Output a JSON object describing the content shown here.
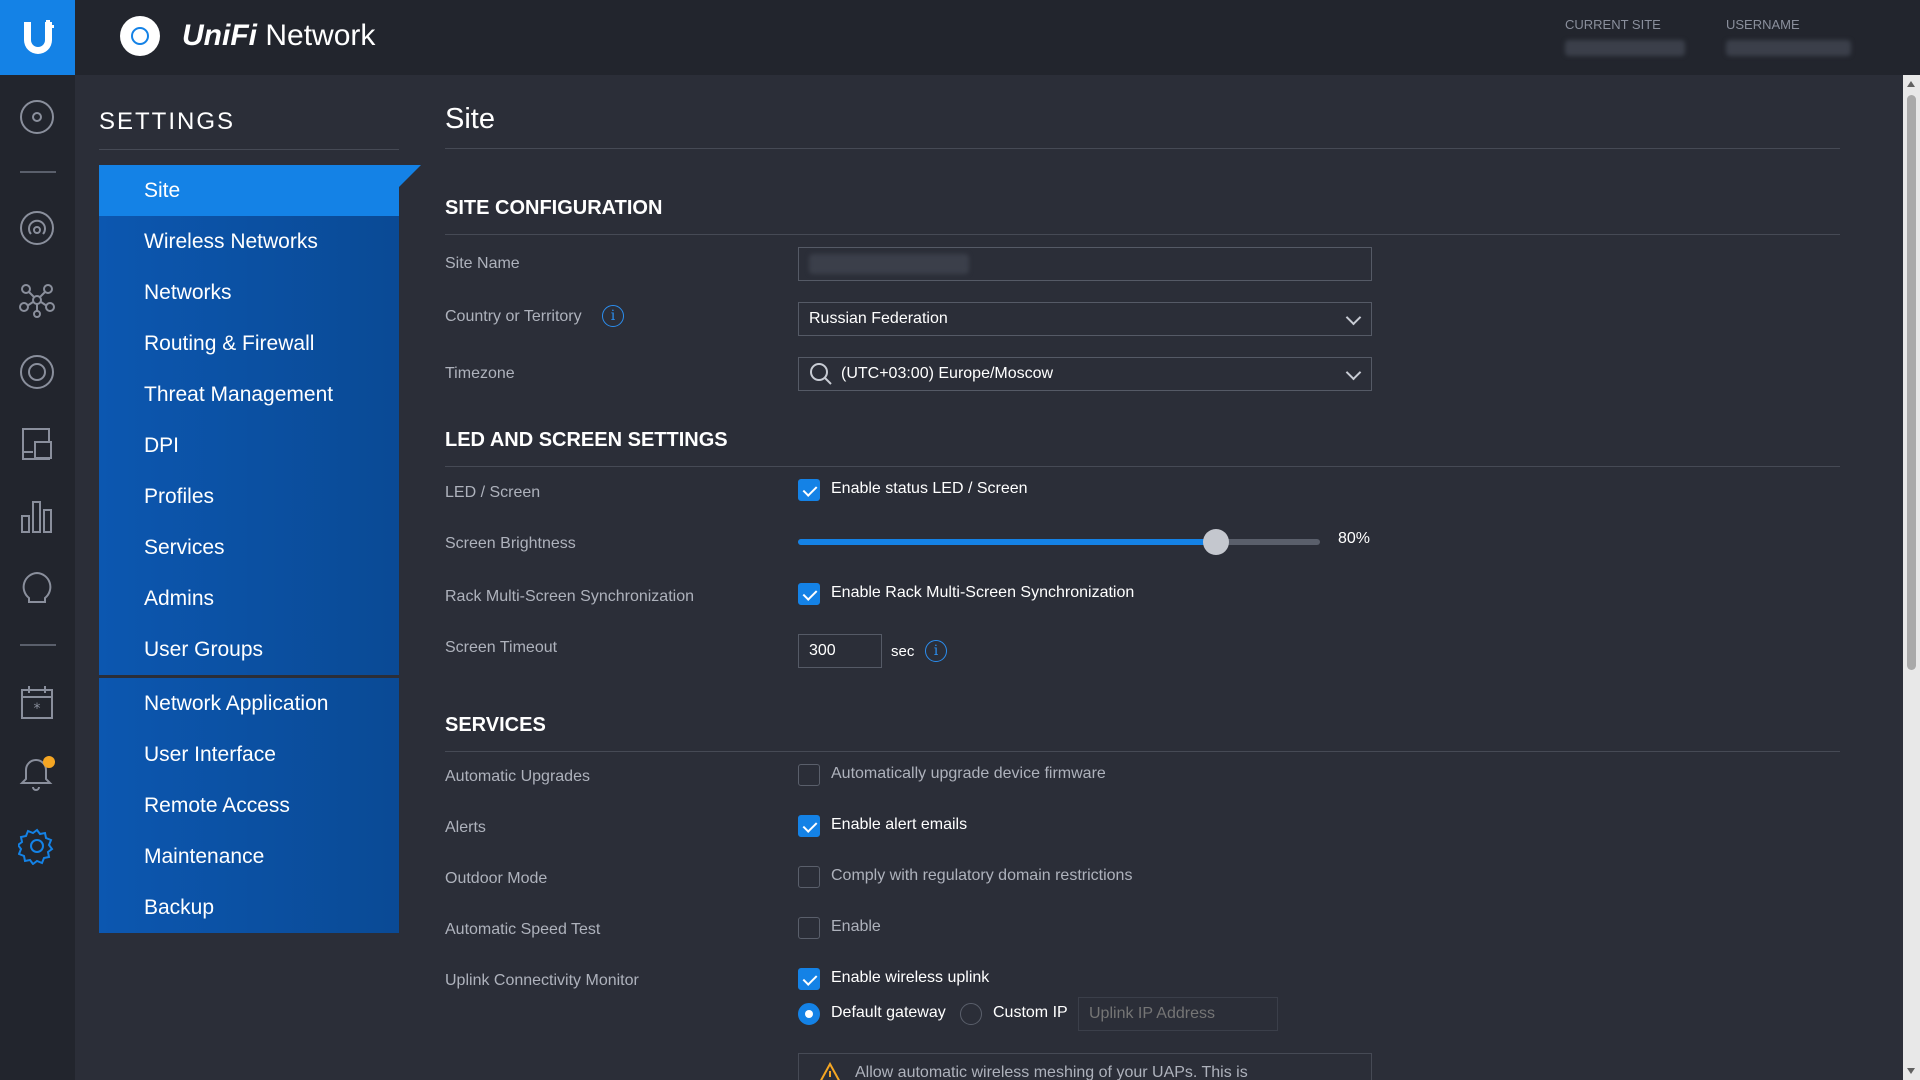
{
  "app": {
    "brand_prefix": "UniFi",
    "brand_suffix": "Network",
    "current_site_label": "CURRENT SITE",
    "username_label": "USERNAME"
  },
  "settings": {
    "title": "SETTINGS",
    "menu_group1": [
      {
        "label": "Site",
        "active": true
      },
      {
        "label": "Wireless Networks"
      },
      {
        "label": "Networks"
      },
      {
        "label": "Routing & Firewall"
      },
      {
        "label": "Threat Management"
      },
      {
        "label": "DPI"
      },
      {
        "label": "Profiles"
      },
      {
        "label": "Services"
      },
      {
        "label": "Admins"
      },
      {
        "label": "User Groups"
      }
    ],
    "menu_group2": [
      {
        "label": "Network Application"
      },
      {
        "label": "User Interface"
      },
      {
        "label": "Remote Access"
      },
      {
        "label": "Maintenance"
      },
      {
        "label": "Backup"
      }
    ]
  },
  "rail_icons": [
    "dashboard-icon",
    "topology-icon",
    "devices-icon",
    "clients-icon",
    "insights-icon",
    "statistics-icon",
    "alerts-icon",
    "events-icon",
    "notifications-icon",
    "settings-icon"
  ],
  "page": {
    "title": "Site",
    "site_config": {
      "heading": "SITE CONFIGURATION",
      "site_name_label": "Site Name",
      "country_label": "Country or Territory",
      "country_value": "Russian Federation",
      "timezone_label": "Timezone",
      "timezone_value": "(UTC+03:00) Europe/Moscow"
    },
    "led": {
      "heading": "LED AND SCREEN SETTINGS",
      "led_label": "LED / Screen",
      "led_checkbox": "Enable status LED / Screen",
      "brightness_label": "Screen Brightness",
      "brightness_value": "80%",
      "brightness_fraction": 0.8,
      "rack_label": "Rack Multi-Screen Synchronization",
      "rack_checkbox": "Enable Rack Multi-Screen Synchronization",
      "timeout_label": "Screen Timeout",
      "timeout_value": "300",
      "timeout_unit": "sec"
    },
    "services": {
      "heading": "SERVICES",
      "auto_upgrades_label": "Automatic Upgrades",
      "auto_upgrades_checkbox": "Automatically upgrade device firmware",
      "alerts_label": "Alerts",
      "alerts_checkbox": "Enable alert emails",
      "outdoor_label": "Outdoor Mode",
      "outdoor_checkbox": "Comply with regulatory domain restrictions",
      "speedtest_label": "Automatic Speed Test",
      "speedtest_checkbox": "Enable",
      "uplink_label": "Uplink Connectivity Monitor",
      "uplink_checkbox": "Enable wireless uplink",
      "default_gateway": "Default gateway",
      "custom_ip": "Custom IP",
      "uplink_placeholder": "Uplink IP Address",
      "notice_text": "Allow automatic wireless meshing of your UAPs. This is"
    }
  },
  "colors": {
    "accent": "#1482e6",
    "background": "#2b2e38",
    "topbar": "#22252d",
    "menu": "#0b4f9c"
  }
}
